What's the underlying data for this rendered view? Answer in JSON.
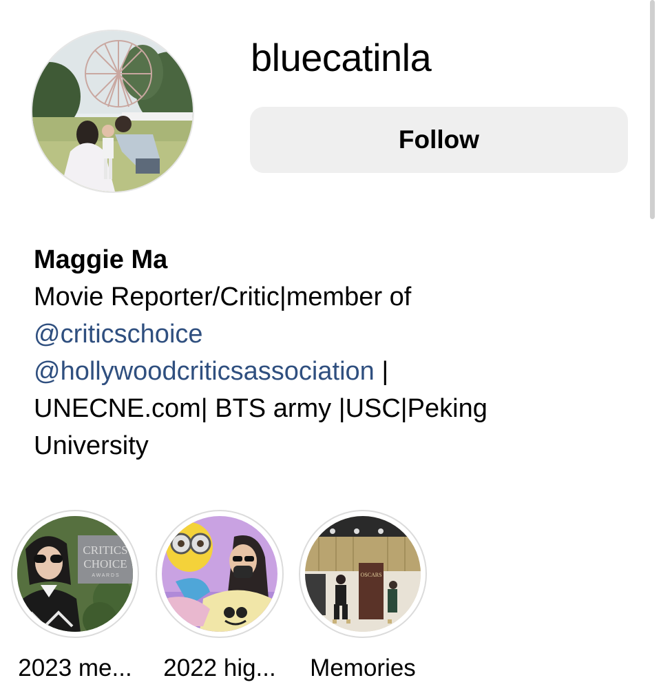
{
  "profile": {
    "username": "bluecatinla",
    "follow_label": "Follow",
    "avatar_icon": "profile-photo-ferris-wheel-family",
    "bio": {
      "name": "Maggie Ma",
      "line1": "Movie Reporter/Critic|member of",
      "mention1": "@criticschoice",
      "mention2": "@hollywoodcriticsassociation",
      "after_mention2": " |",
      "line4": "UNECNE.com| BTS army |USC|Peking",
      "line5": "University",
      "mention_color": "#2f4f7f"
    }
  },
  "highlights": [
    {
      "label": "2023 me...",
      "icon": "critics-choice-awards-photo"
    },
    {
      "label": "2022 hig...",
      "icon": "minion-themed-photo"
    },
    {
      "label": "Memories",
      "icon": "oscars-stage-photo"
    }
  ],
  "colors": {
    "button_bg": "#efefef",
    "ring": "#dbdbdb",
    "link": "#2f4f7f"
  }
}
